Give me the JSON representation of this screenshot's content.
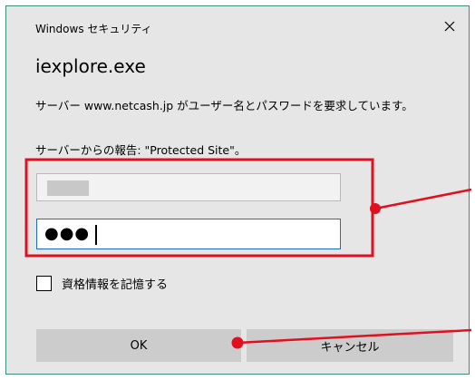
{
  "window": {
    "title": "Windows セキュリティ",
    "close_glyph": "✕"
  },
  "dialog": {
    "app_name": "iexplore.exe",
    "server_message": "サーバー www.netcash.jp がユーザー名とパスワードを要求しています。",
    "realm_message": "サーバーからの報告: \"Protected Site\"。"
  },
  "credentials": {
    "username_value": "",
    "password_dots": "●●●"
  },
  "remember": {
    "label": "資格情報を記憶する",
    "checked": false
  },
  "buttons": {
    "ok_label": "OK",
    "cancel_label": "キャンセル"
  },
  "colors": {
    "dialog_bg": "#e6e6e6",
    "window_border": "#3e8e7e",
    "focus_border": "#1b6ec2",
    "annotation_red": "#e0101e"
  }
}
